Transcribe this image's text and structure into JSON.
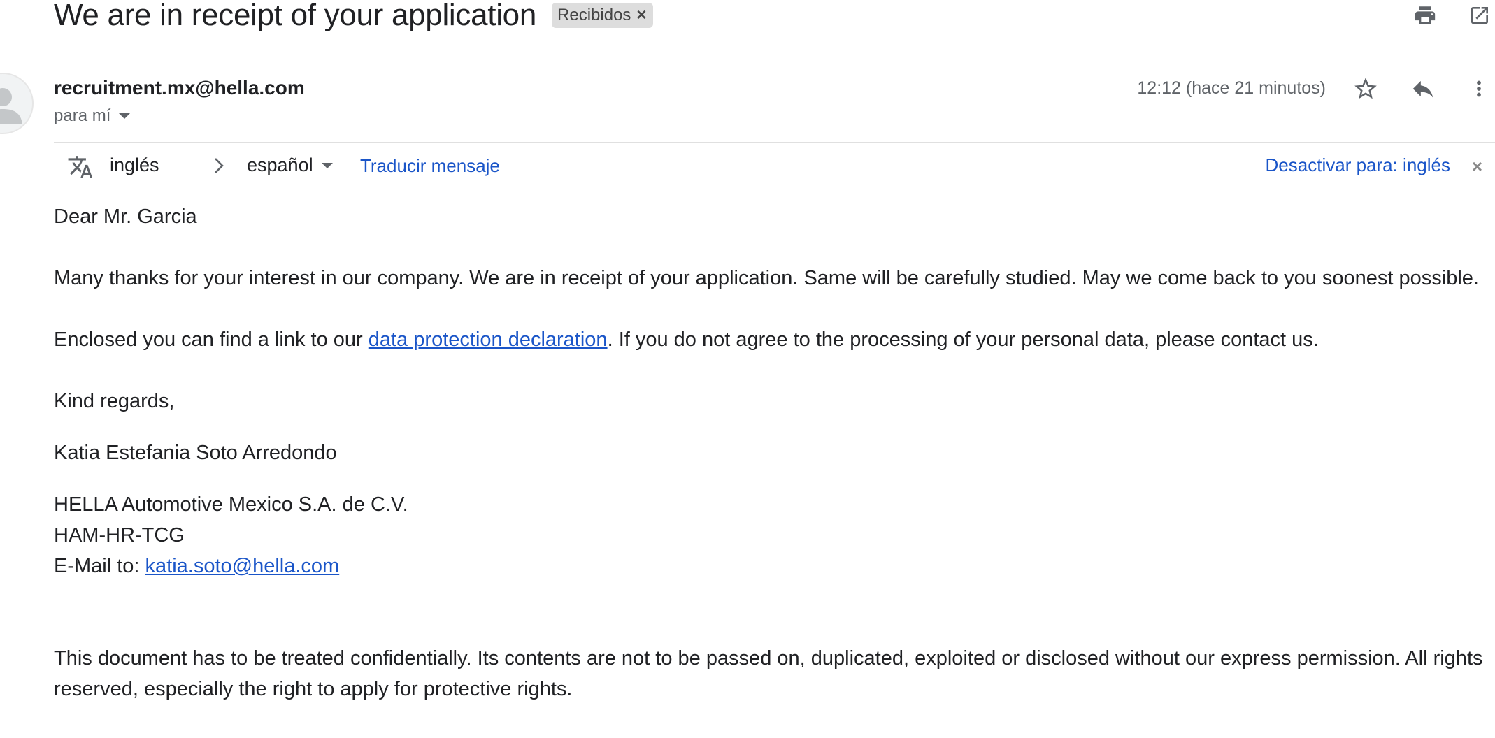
{
  "header": {
    "subject": "We are in receipt of your application",
    "label": "Recibidos",
    "label_remove": "×"
  },
  "icons": {
    "print": "print-icon",
    "open_new_window": "open-in-new-window-icon",
    "star": "star-icon",
    "reply": "reply-icon",
    "more": "more-vertical-icon",
    "translate": "translate-icon",
    "arrow": "chevron-right-icon",
    "avatar": "person-avatar-icon"
  },
  "message": {
    "sender": "recruitment.mx@hella.com",
    "to": "para mí",
    "timestamp": "12:12 (hace 21 minutos)"
  },
  "translate_bar": {
    "source_lang": "inglés",
    "target_lang": "español",
    "translate_link": "Traducir mensaje",
    "disable_link": "Desactivar para: inglés",
    "close": "×"
  },
  "body": {
    "greeting": "Dear Mr. Garcia",
    "para1": "Many thanks for your interest in our company. We are in receipt of your application. Same will be carefully studied. May we come back to you soonest possible.",
    "para2_before": "Enclosed you can find a link to our ",
    "para2_link": "data protection declaration",
    "para2_after": ". If you do not agree to the processing of your personal data, please contact us.",
    "closing": "Kind regards,",
    "signature_name": "Katia Estefania Soto Arredondo",
    "company": "HELLA Automotive Mexico S.A. de C.V.",
    "department": "HAM-HR-TCG",
    "email_label": "E-Mail to: ",
    "email_link": "katia.soto@hella.com",
    "disclaimer": "This document has to be treated confidentially. Its contents are not to be passed on, duplicated, exploited or disclosed without our express permission. All rights reserved, especially the right to apply for protective rights."
  },
  "colors": {
    "link": "#1a55c8",
    "text": "#202124",
    "muted": "#5f6368",
    "chip_bg": "#dddddd"
  }
}
